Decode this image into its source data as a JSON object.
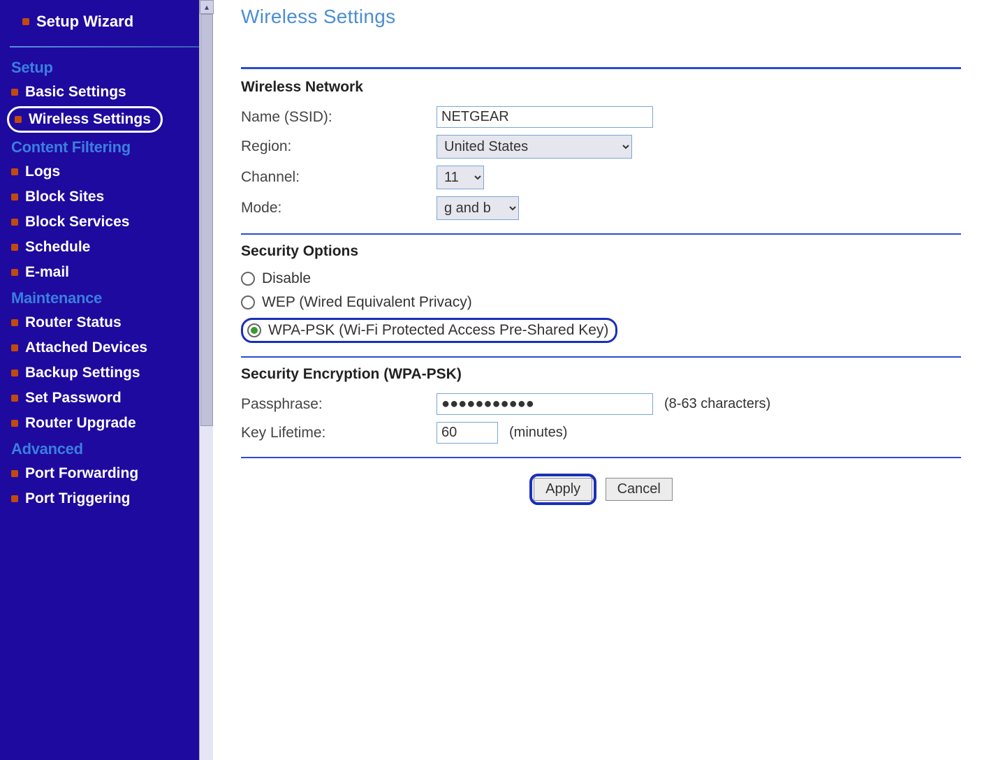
{
  "sidebar": {
    "top": "Setup Wizard",
    "sections": [
      {
        "label": "Setup",
        "items": [
          {
            "label": "Basic Settings",
            "highlighted": false
          },
          {
            "label": "Wireless Settings",
            "highlighted": true
          }
        ]
      },
      {
        "label": "Content Filtering",
        "items": [
          {
            "label": "Logs"
          },
          {
            "label": "Block Sites"
          },
          {
            "label": "Block Services"
          },
          {
            "label": "Schedule"
          },
          {
            "label": "E-mail"
          }
        ]
      },
      {
        "label": "Maintenance",
        "items": [
          {
            "label": "Router Status"
          },
          {
            "label": "Attached Devices"
          },
          {
            "label": "Backup Settings"
          },
          {
            "label": "Set Password"
          },
          {
            "label": "Router Upgrade"
          }
        ]
      },
      {
        "label": "Advanced",
        "items": [
          {
            "label": "Port Forwarding"
          },
          {
            "label": "Port Triggering"
          }
        ]
      }
    ]
  },
  "page": {
    "title": "Wireless Settings"
  },
  "wireless_network": {
    "heading": "Wireless Network",
    "ssid_label": "Name (SSID):",
    "ssid_value": "NETGEAR",
    "region_label": "Region:",
    "region_value": "United States",
    "channel_label": "Channel:",
    "channel_value": "11",
    "mode_label": "Mode:",
    "mode_value": "g and b"
  },
  "security_options": {
    "heading": "Security Options",
    "options": {
      "disable": "Disable",
      "wep": "WEP (Wired Equivalent Privacy)",
      "wpa_psk": "WPA-PSK (Wi-Fi Protected Access Pre-Shared Key)"
    },
    "selected": "wpa_psk"
  },
  "security_encryption": {
    "heading": "Security Encryption (WPA-PSK)",
    "passphrase_label": "Passphrase:",
    "passphrase_value": "●●●●●●●●●●●",
    "passphrase_hint": "(8-63 characters)",
    "lifetime_label": "Key Lifetime:",
    "lifetime_value": "60",
    "lifetime_unit": "(minutes)"
  },
  "buttons": {
    "apply": "Apply",
    "cancel": "Cancel"
  }
}
